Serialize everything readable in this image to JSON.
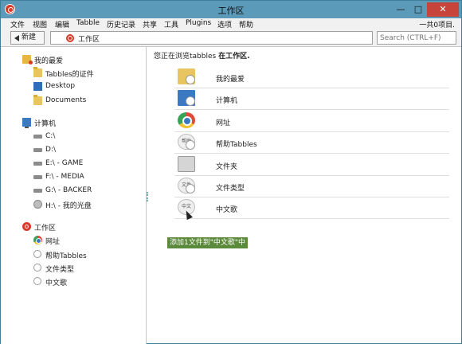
{
  "window": {
    "title": "工作区",
    "min": "—",
    "max": "□",
    "close": "✕"
  },
  "menubar": {
    "items": [
      "文件",
      "视图",
      "编辑",
      "Tabble",
      "历史记录",
      "共享",
      "工具",
      "Plugins",
      "选项",
      "帮助"
    ],
    "item_count": "一共0项目."
  },
  "toolbar": {
    "back_label": "新建",
    "address": "工作区",
    "search_placeholder": "Search (CTRL+F)"
  },
  "sidebar": {
    "favorites": {
      "label": "我的最爱",
      "items": [
        "Tabbles的证件",
        "Desktop",
        "Documents"
      ]
    },
    "computer": {
      "label": "计算机",
      "drives": [
        "C:\\",
        "D:\\",
        "E:\\ - GAME",
        "F:\\ - MEDIA",
        "G:\\ - BACKER",
        "H:\\ - 我的光盘"
      ]
    },
    "workspace": {
      "label": "工作区",
      "items": [
        "网址",
        "帮助Tabbles",
        "文件类型",
        "中文歌"
      ]
    }
  },
  "main": {
    "heading_prefix": "您正在浏览tabbles",
    "heading_location": "在工作区.",
    "rows": [
      {
        "label": "我的最爱",
        "icon": "favorites-folder-icon"
      },
      {
        "label": "计算机",
        "icon": "computer-icon"
      },
      {
        "label": "网址",
        "icon": "web-icon"
      },
      {
        "label": "帮助Tabbles",
        "icon": "tabble-icon",
        "badge_text": "帮助"
      },
      {
        "label": "文件夹",
        "icon": "folder-icon"
      },
      {
        "label": "文件类型",
        "icon": "tabble-icon",
        "badge_text": "文件"
      },
      {
        "label": "中文歌",
        "icon": "tabble-icon",
        "badge_text": "中文"
      }
    ],
    "tooltip": "添加1文件到\"中文歌\"中"
  },
  "colors": {
    "accent_red": "#d83a2a",
    "tooltip_green": "#5a8a3a",
    "chrome_blue": "#5b9bb9"
  }
}
